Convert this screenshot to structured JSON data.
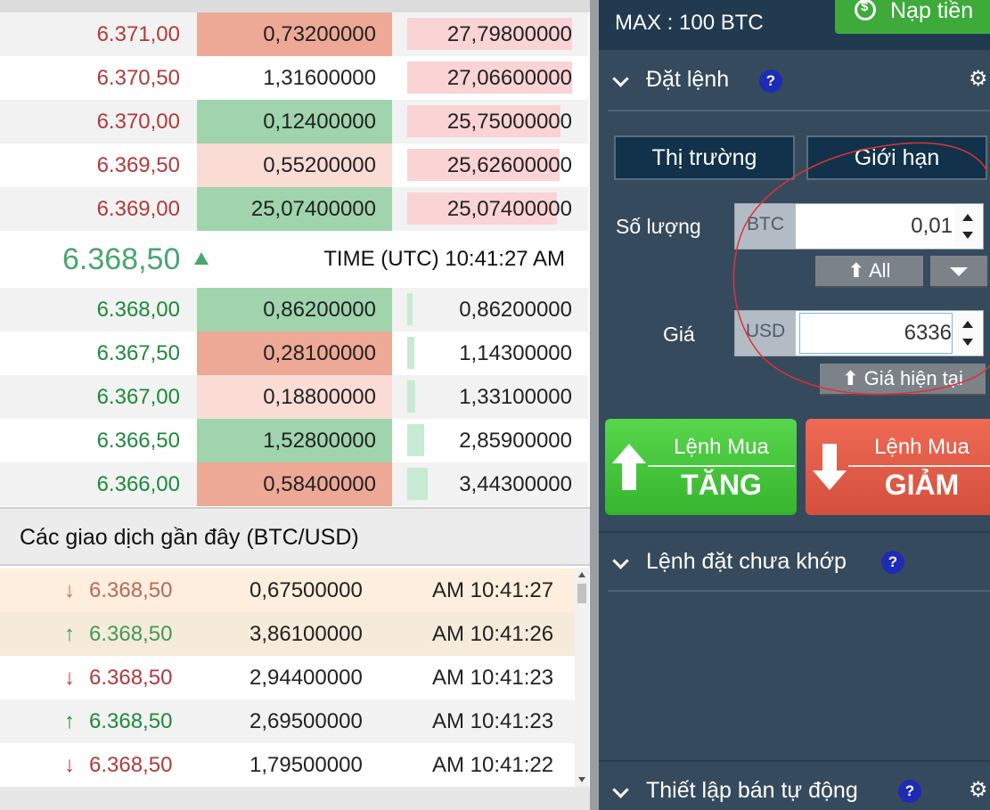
{
  "orderbook": {
    "asks": [
      {
        "price": "6.371,00",
        "amount": "0,73200000",
        "total": "27,79800000"
      },
      {
        "price": "6.370,50",
        "amount": "1,31600000",
        "total": "27,06600000"
      },
      {
        "price": "6.370,00",
        "amount": "0,12400000",
        "total": "25,75000000"
      },
      {
        "price": "6.369,50",
        "amount": "0,55200000",
        "total": "25,62600000"
      },
      {
        "price": "6.369,00",
        "amount": "25,07400000",
        "total": "25,07400000"
      }
    ],
    "last_price": "6.368,50",
    "time_label": "TIME (UTC) 10:41:27 AM",
    "bids": [
      {
        "price": "6.368,00",
        "amount": "0,86200000",
        "total": "0,86200000"
      },
      {
        "price": "6.367,50",
        "amount": "0,28100000",
        "total": "1,14300000"
      },
      {
        "price": "6.367,00",
        "amount": "0,18800000",
        "total": "1,33100000"
      },
      {
        "price": "6.366,50",
        "amount": "1,52800000",
        "total": "2,85900000"
      },
      {
        "price": "6.366,00",
        "amount": "0,58400000",
        "total": "3,44300000"
      }
    ]
  },
  "recent_trades": {
    "title": "Các giao dịch gần đây (BTC/USD)",
    "rows": [
      {
        "dir": "↓",
        "price": "6.368,50",
        "amount": "0,67500000",
        "time": "AM 10:41:27"
      },
      {
        "dir": "↑",
        "price": "6.368,50",
        "amount": "3,86100000",
        "time": "AM 10:41:26"
      },
      {
        "dir": "↓",
        "price": "6.368,50",
        "amount": "2,94400000",
        "time": "AM 10:41:23"
      },
      {
        "dir": "↑",
        "price": "6.368,50",
        "amount": "2,69500000",
        "time": "AM 10:41:23"
      },
      {
        "dir": "↓",
        "price": "6.368,50",
        "amount": "1,79500000",
        "time": "AM 10:41:22"
      }
    ]
  },
  "right": {
    "max_label": "MAX : 100 BTC",
    "deposit_label": "Nạp tiền",
    "place_order_title": "Đặt lệnh",
    "help": "?",
    "market_tab": "Thị trường",
    "limit_tab": "Giới hạn",
    "quantity_label": "Số lượng",
    "quantity_unit": "BTC",
    "quantity_value": "0,01",
    "all_label": "All",
    "price_label": "Giá",
    "price_unit": "USD",
    "price_value": "6336",
    "current_price_label": "Giá hiện tại",
    "buy_line1": "Lệnh Mua",
    "buy_line2": "TĂNG",
    "sell_line1": "Lệnh Mua",
    "sell_line2": "GIẢM",
    "pending_title": "Lệnh đặt chưa khớp",
    "auto_sell_title": "Thiết lập bán tự động"
  },
  "colors": {
    "ask_price": "#b23a3a",
    "bid_price": "#1d8a3a",
    "panel_bg": "#364a5d",
    "buy_green": "#3dbb33",
    "sell_red": "#e05c47",
    "annotation_red": "#d33"
  }
}
